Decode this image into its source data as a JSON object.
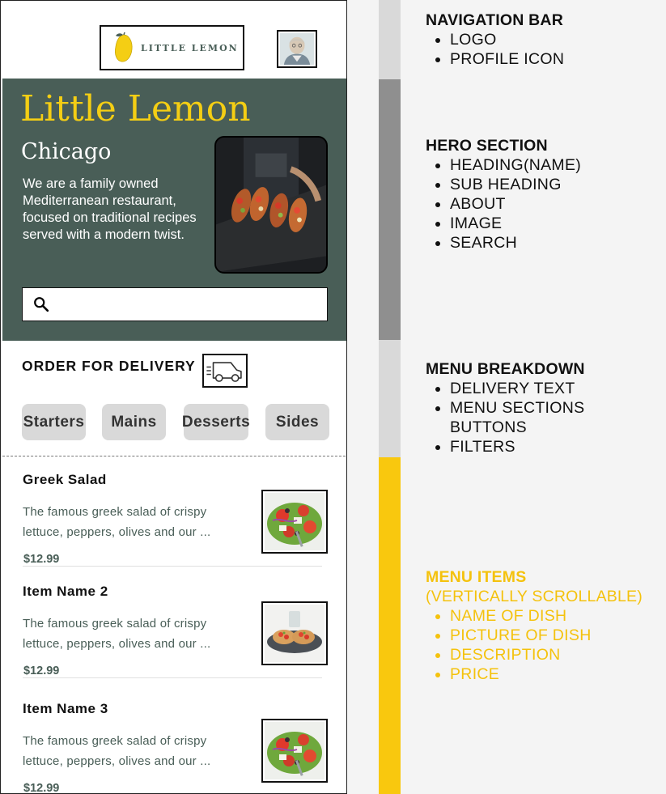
{
  "nav": {
    "logo_text": "LITTLE LEMON",
    "profile_icon": "profile-photo"
  },
  "hero": {
    "title": "Little Lemon",
    "subtitle": "Chicago",
    "about": "We are a family owned Mediterranean restaurant, focused on traditional recipes served with a modern twist.",
    "search_placeholder": "",
    "colors": {
      "background": "#495e57",
      "title": "#f4ce14"
    }
  },
  "delivery": {
    "label": "ORDER FOR DELIVERY",
    "icon": "delivery-truck-icon"
  },
  "categories": [
    "Starters",
    "Mains",
    "Desserts",
    "Sides"
  ],
  "menu_items": [
    {
      "name": "Greek Salad",
      "description": "The famous greek salad of crispy lettuce, peppers, olives and our ...",
      "price": "$12.99",
      "image": "greek-salad"
    },
    {
      "name": "Item Name 2",
      "description": "The famous greek salad of crispy lettuce, peppers, olives and our ...",
      "price": "$12.99",
      "image": "bruschetta-plate"
    },
    {
      "name": "Item Name 3",
      "description": "The famous greek salad of crispy lettuce, peppers, olives and our ...",
      "price": "$12.99",
      "image": "greek-salad"
    }
  ],
  "annotations": {
    "nav": {
      "title": "NAVIGATION BAR",
      "items": [
        "LOGO",
        "PROFILE ICON"
      ]
    },
    "hero": {
      "title": "HERO SECTION",
      "items": [
        "HEADING(NAME)",
        "SUB HEADING",
        "ABOUT",
        "IMAGE",
        "SEARCH"
      ]
    },
    "menu_breakdown": {
      "title": "MENU BREAKDOWN",
      "items": [
        "DELIVERY TEXT",
        "MENU SECTIONS BUTTONS",
        "FILTERS"
      ]
    },
    "menu_items": {
      "title": "MENU ITEMS",
      "subtitle": "(VERTICALLY SCROLLABLE)",
      "items": [
        "NAME OF DISH",
        "PICTURE OF DISH",
        "DESCRIPTION",
        "PRICE"
      ]
    },
    "bar_colors": [
      "#d9d9d9",
      "#8f8f8f",
      "#d9d9d9",
      "#f9c80e"
    ]
  }
}
